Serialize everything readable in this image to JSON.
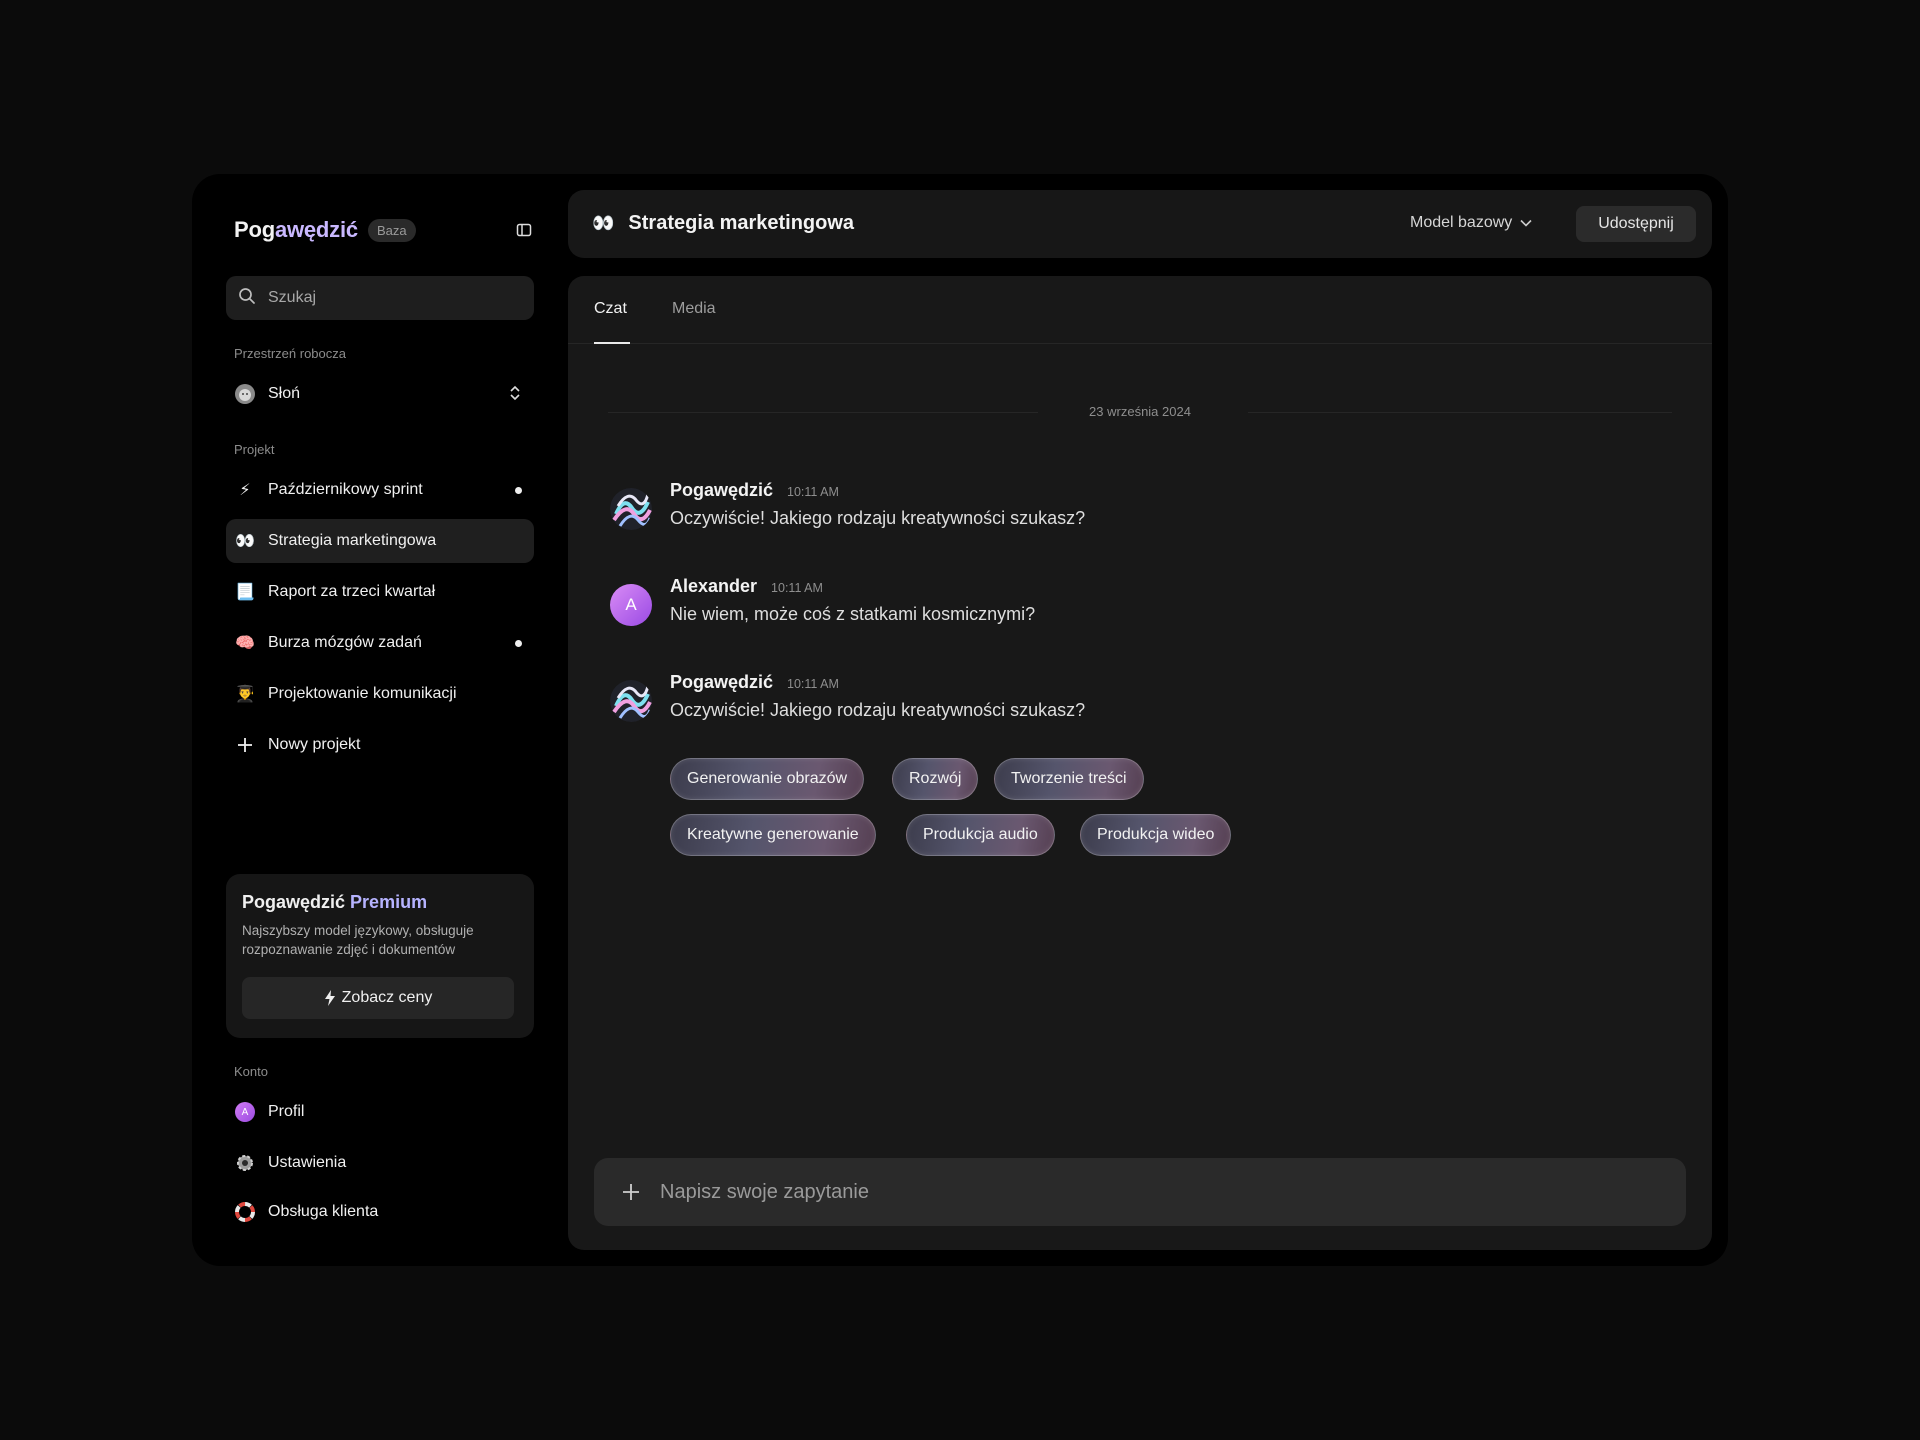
{
  "sidebar": {
    "brand_prefix": "Pog",
    "brand_mid": "awędzić",
    "brand_badge": "Baza",
    "search_placeholder": "Szukaj",
    "workspace_label": "Przestrzeń robocza",
    "workspace_name": "Słoń",
    "project_label": "Projekt",
    "projects": [
      {
        "icon": "⚡",
        "label": "Październikowy sprint",
        "dot": true
      },
      {
        "icon": "👀",
        "label": "Strategia marketingowa",
        "active": true
      },
      {
        "icon": "📃",
        "label": "Raport za trzeci kwartał"
      },
      {
        "icon": "🧠",
        "label": "Burza mózgów zadań",
        "dot": true
      },
      {
        "icon": "👨‍🎓",
        "label": "Projektowanie komunikacji"
      },
      {
        "icon": "+",
        "label": "Nowy projekt"
      }
    ],
    "premium": {
      "title_prefix": "Pogawędzić",
      "title_accent": "Premium",
      "description": "Najszybszy model językowy, obsługuje rozpoznawanie zdjęć i dokumentów",
      "button": "Zobacz ceny"
    },
    "account_label": "Konto",
    "account": [
      {
        "icon": "avatar",
        "label": "Profil"
      },
      {
        "icon": "gear-icon",
        "label": "Ustawienia"
      },
      {
        "icon": "lifebuoy-icon",
        "label": "Obsługa klienta"
      }
    ],
    "avatar_letter": "A"
  },
  "header": {
    "icon": "👀",
    "title": "Strategia marketingowa",
    "model": "Model bazowy",
    "share": "Udostępnij"
  },
  "tabs": [
    "Czat",
    "Media"
  ],
  "date_separator": "23 września 2024",
  "messages": [
    {
      "name": "Pogawędzić",
      "time": "10:11 AM",
      "text": "Oczywiście! Jakiego rodzaju kreatywności szukasz?"
    },
    {
      "name": "Alexander",
      "time": "10:11 AM",
      "text": "Nie wiem, może coś z statkami kosmicznymi?",
      "avatar_letter": "A"
    },
    {
      "name": "Pogawędzić",
      "time": "10:11 AM",
      "text": "Oczywiście! Jakiego rodzaju kreatywności szukasz?"
    }
  ],
  "suggestions": [
    "Generowanie obrazów",
    "Rozwój",
    "Tworzenie treści",
    "Kreatywne generowanie",
    "Produkcja audio",
    "Produkcja wideo"
  ],
  "composer": {
    "placeholder": "Napisz swoje zapytanie"
  },
  "colors": {
    "accent": "#c9b8ff",
    "avatar_gradient_start": "#d98cf5",
    "avatar_gradient_end": "#9a4ae4"
  }
}
